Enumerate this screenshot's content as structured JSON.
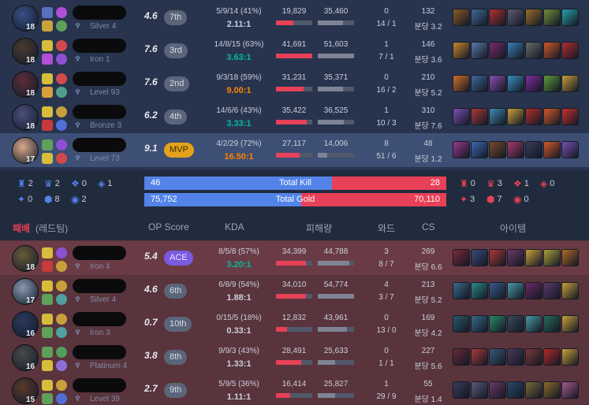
{
  "blue_team": {
    "players": [
      {
        "level": "18",
        "tier": "Silver 4",
        "op": "4.6",
        "rank": "7th",
        "rank_type": "normal",
        "kda": "5/9/14 (41%)",
        "ratio": "2.11:1",
        "ratio_color": "#c9cfdb",
        "dealt": "19,829",
        "taken": "35,460",
        "dealt_pct": 0.48,
        "taken_pct": 0.69,
        "ward1": "0",
        "ward2": "14 / 1",
        "cs": "132",
        "cs_min": "분당 3.2",
        "highlight": false,
        "champ_color": "#3a4f86",
        "spells": [
          "#5b6fbf",
          "#caa43a"
        ],
        "runes": [
          "#b14fd6",
          "#5fa05a"
        ],
        "items": [
          "#8a5a2b",
          "#3f6a9a",
          "#b03030",
          "#5d5d72",
          "#9a6e2a",
          "#6f8f3a",
          "#2aa0a8"
        ]
      },
      {
        "level": "18",
        "tier": "Iron 1",
        "op": "7.6",
        "rank": "3rd",
        "rank_type": "normal",
        "kda": "14/8/15 (63%)",
        "ratio": "3.63:1",
        "ratio_color": "#00bba3",
        "dealt": "41,691",
        "taken": "51,603",
        "dealt_pct": 1.0,
        "taken_pct": 1.0,
        "ward1": "1",
        "ward2": "7 / 1",
        "cs": "146",
        "cs_min": "분당 3.6",
        "highlight": false,
        "champ_color": "#4b3a30",
        "spells": [
          "#d6bd3b",
          "#b14fd6"
        ],
        "runes": [
          "#d24a4a",
          "#8c4fd6"
        ],
        "items": [
          "#c7882c",
          "#5a7aa8",
          "#7b2c6c",
          "#3e7fb5",
          "#6b6b6b",
          "#d05a2a",
          "#b33030"
        ]
      },
      {
        "level": "18",
        "tier": "Level 93",
        "op": "7.6",
        "rank": "2nd",
        "rank_type": "normal",
        "kda": "9/3/18 (59%)",
        "ratio": "9.00:1",
        "ratio_color": "#ff8200",
        "dealt": "31,231",
        "taken": "35,371",
        "dealt_pct": 0.75,
        "taken_pct": 0.69,
        "ward1": "0",
        "ward2": "16 / 2",
        "cs": "210",
        "cs_min": "분당 5.2",
        "highlight": false,
        "champ_color": "#5a2f38",
        "spells": [
          "#d6bd3b",
          "#d6a03b"
        ],
        "runes": [
          "#d24a4a",
          "#4fa08a"
        ],
        "items": [
          "#d0702a",
          "#3f6a9a",
          "#8c4fb0",
          "#3a8fc0",
          "#7f2ea0",
          "#5f9a3a",
          "#c8a03a"
        ]
      },
      {
        "level": "18",
        "tier": "Bronze 3",
        "op": "6.2",
        "rank": "4th",
        "rank_type": "normal",
        "kda": "14/6/6 (43%)",
        "ratio": "3.33:1",
        "ratio_color": "#00bba3",
        "dealt": "35,422",
        "taken": "36,525",
        "dealt_pct": 0.85,
        "taken_pct": 0.71,
        "ward1": "1",
        "ward2": "10 / 3",
        "cs": "310",
        "cs_min": "분당 7.6",
        "highlight": false,
        "champ_color": "#4b4f7a",
        "spells": [
          "#d6bd3b",
          "#c83a3a"
        ],
        "runes": [
          "#c8a03a",
          "#4f70d6"
        ],
        "items": [
          "#7a4fb0",
          "#a83a3a",
          "#3f8ab0",
          "#c8a03a",
          "#b0302a",
          "#d05a2a",
          "#c83030"
        ]
      },
      {
        "level": "17",
        "tier": "Level 73",
        "op": "9.1",
        "rank": "MVP",
        "rank_type": "mvp",
        "kda": "4/2/29 (72%)",
        "ratio": "16.50:1",
        "ratio_color": "#ff8200",
        "dealt": "27,117",
        "taken": "14,006",
        "dealt_pct": 0.65,
        "taken_pct": 0.27,
        "ward1": "8",
        "ward2": "51 / 6",
        "cs": "48",
        "cs_min": "분당 1.2",
        "highlight": true,
        "champ_color": "#d9a98a",
        "spells": [
          "#5fa05a",
          "#d6bd3b"
        ],
        "runes": [
          "#8c4fd6",
          "#d24a4a"
        ],
        "items": [
          "#9a3a8c",
          "#3a6ab0",
          "#7a4a2a",
          "#a83a6a",
          "#3a3a5a",
          "#d05a2a",
          "#7a4fb0"
        ]
      }
    ]
  },
  "summary": {
    "blue_objectives": [
      {
        "icon": "♜",
        "value": "2"
      },
      {
        "icon": "♛",
        "value": "2"
      },
      {
        "icon": "❖",
        "value": "0"
      },
      {
        "icon": "◈",
        "value": "1"
      },
      {
        "icon": "✦",
        "value": "0"
      },
      {
        "icon": "⬢",
        "value": "8"
      },
      {
        "icon": "◉",
        "value": "2"
      }
    ],
    "red_objectives": [
      {
        "icon": "♜",
        "value": "0"
      },
      {
        "icon": "♛",
        "value": "3"
      },
      {
        "icon": "❖",
        "value": "1"
      },
      {
        "icon": "◈",
        "value": "0"
      },
      {
        "icon": "✦",
        "value": "3"
      },
      {
        "icon": "⬢",
        "value": "7"
      },
      {
        "icon": "◉",
        "value": "0"
      }
    ],
    "kill": {
      "label": "Total Kill",
      "blue": "46",
      "red": "28",
      "blue_frac": 0.621
    },
    "gold": {
      "label": "Total Gold",
      "blue": "75,752",
      "red": "70,110",
      "blue_frac": 0.519
    }
  },
  "header": {
    "result": "패배",
    "side": "(레드팀)",
    "op_score": "OP Score",
    "kda": "KDA",
    "damage": "피해량",
    "ward": "와드",
    "cs": "CS",
    "items": "아이템"
  },
  "red_team": {
    "players": [
      {
        "level": "18",
        "tier": "Iron 4",
        "op": "5.4",
        "rank": "ACE",
        "rank_type": "ace",
        "kda": "8/5/8 (57%)",
        "ratio": "3.20:1",
        "ratio_color": "#00bba3",
        "dealt": "34,399",
        "taken": "44,788",
        "dealt_pct": 0.83,
        "taken_pct": 0.87,
        "ward1": "3",
        "ward2": "8 / 7",
        "cs": "269",
        "cs_min": "분당 6.6",
        "highlight": true,
        "champ_color": "#6a5a3a",
        "spells": [
          "#d6bd3b",
          "#c83a3a"
        ],
        "runes": [
          "#8c4fd6",
          "#c8a03a"
        ],
        "items": [
          "#7a2a3a",
          "#3a4a7a",
          "#a83a3a",
          "#6a3a6a",
          "#c8a03a",
          "#a8a03a",
          "#b06a2a"
        ]
      },
      {
        "level": "17",
        "tier": "Silver 4",
        "op": "4.6",
        "rank": "6th",
        "rank_type": "normal",
        "kda": "6/8/9 (54%)",
        "ratio": "1.88:1",
        "ratio_color": "#c9cfdb",
        "dealt": "34,010",
        "taken": "54,774",
        "dealt_pct": 0.82,
        "taken_pct": 1.0,
        "ward1": "4",
        "ward2": "3 / 7",
        "cs": "213",
        "cs_min": "분당 5.2",
        "highlight": false,
        "champ_color": "#8a9ab0",
        "spells": [
          "#d6bd3b",
          "#5fa05a"
        ],
        "runes": [
          "#c8a03a",
          "#4fa0a0"
        ],
        "items": [
          "#3a6a8a",
          "#2a8a8a",
          "#3a5a8a",
          "#4a9aa8",
          "#6a2a6a",
          "#5a3a6a",
          "#c8a03a"
        ]
      },
      {
        "level": "16",
        "tier": "Iron 3",
        "op": "0.7",
        "rank": "10th",
        "rank_type": "normal",
        "kda": "0/15/5 (18%)",
        "ratio": "0.33:1",
        "ratio_color": "#c9cfdb",
        "dealt": "12,832",
        "taken": "43,961",
        "dealt_pct": 0.31,
        "taken_pct": 0.8,
        "ward1": "0",
        "ward2": "13 / 0",
        "cs": "169",
        "cs_min": "분당 4.2",
        "highlight": false,
        "champ_color": "#2a3a5a",
        "spells": [
          "#d6bd3b",
          "#5fa05a"
        ],
        "runes": [
          "#c8a03a",
          "#4fa0a0"
        ],
        "items": [
          "#2a5a6a",
          "#3a6a8a",
          "#2a8a6a",
          "#3a4a5a",
          "#4a9aa8",
          "#2a6a5a",
          "#c8a03a"
        ]
      },
      {
        "level": "16",
        "tier": "Platinum 4",
        "op": "3.8",
        "rank": "8th",
        "rank_type": "normal",
        "kda": "9/9/3 (43%)",
        "ratio": "1.33:1",
        "ratio_color": "#c9cfdb",
        "dealt": "28,491",
        "taken": "25,633",
        "dealt_pct": 0.69,
        "taken_pct": 0.47,
        "ward1": "0",
        "ward2": "1 / 1",
        "cs": "227",
        "cs_min": "분당 5.6",
        "highlight": false,
        "champ_color": "#4a4a4a",
        "spells": [
          "#5fa05a",
          "#d6bd3b"
        ],
        "runes": [
          "#4fa05a",
          "#8c6fd6"
        ],
        "items": [
          "#6a2a3a",
          "#a83a3a",
          "#3a5a7a",
          "#4a3a5a",
          "#7a3a3a",
          "#b02a2a",
          "#c8a03a"
        ]
      },
      {
        "level": "15",
        "tier": "Level 39",
        "op": "2.7",
        "rank": "9th",
        "rank_type": "normal",
        "kda": "5/9/5 (36%)",
        "ratio": "1.11:1",
        "ratio_color": "#c9cfdb",
        "dealt": "16,414",
        "taken": "25,827",
        "dealt_pct": 0.39,
        "taken_pct": 0.47,
        "ward1": "1",
        "ward2": "29 / 9",
        "cs": "55",
        "cs_min": "분당 1.4",
        "highlight": false,
        "champ_color": "#5a3a2a",
        "spells": [
          "#d6bd3b",
          "#5fa05a"
        ],
        "runes": [
          "#c8a03a",
          "#4f6fd6"
        ],
        "items": [
          "#3a3a5a",
          "#5a5a7a",
          "#6a3a6a",
          "#2a4a6a",
          "#7a6a3a",
          "#8a6a2a",
          "#a85a8a"
        ]
      }
    ]
  }
}
